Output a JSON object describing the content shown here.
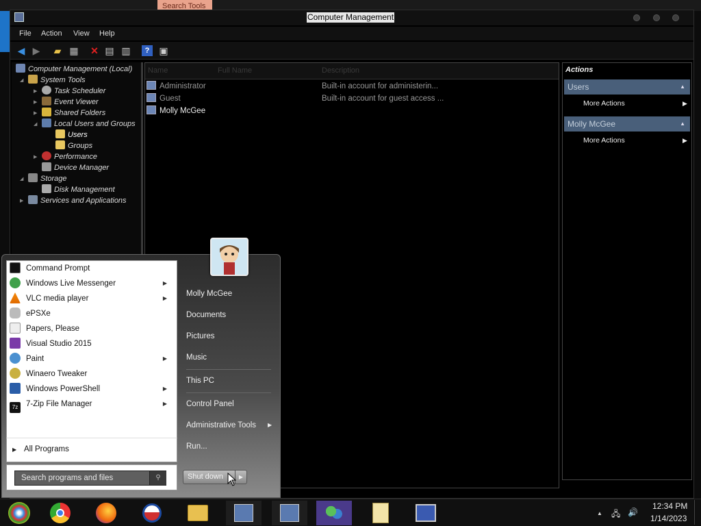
{
  "background": {
    "tab_label": "Search Tools"
  },
  "window": {
    "title": "Computer Management",
    "menu": [
      "File",
      "Action",
      "View",
      "Help"
    ]
  },
  "tree": [
    {
      "label": "Computer Management (Local)"
    },
    {
      "label": "System Tools"
    },
    {
      "label": "Task Scheduler"
    },
    {
      "label": "Event Viewer"
    },
    {
      "label": "Shared Folders"
    },
    {
      "label": "Local Users and Groups"
    },
    {
      "label": "Users"
    },
    {
      "label": "Groups"
    },
    {
      "label": "Performance"
    },
    {
      "label": "Device Manager"
    },
    {
      "label": "Storage"
    },
    {
      "label": "Disk Management"
    },
    {
      "label": "Services and Applications"
    }
  ],
  "list": {
    "columns": [
      "Name",
      "Full Name",
      "Description"
    ],
    "rows": [
      {
        "name": "Administrator",
        "description": "Built-in account for administerin..."
      },
      {
        "name": "Guest",
        "description": "Built-in account for guest access ..."
      },
      {
        "name": "Molly McGee",
        "description": ""
      }
    ]
  },
  "actions": {
    "title": "Actions",
    "sections": [
      {
        "label": "Users",
        "item": "More Actions"
      },
      {
        "label": "Molly McGee",
        "item": "More Actions"
      }
    ]
  },
  "start_menu": {
    "programs": [
      {
        "label": "Command Prompt",
        "icon": "cmd-icon",
        "submenu": false
      },
      {
        "label": "Windows Live Messenger",
        "icon": "messenger-icon",
        "submenu": true
      },
      {
        "label": "VLC media player",
        "icon": "vlc-icon",
        "submenu": true
      },
      {
        "label": "ePSXe",
        "icon": "gamepad-icon",
        "submenu": false
      },
      {
        "label": "Papers, Please",
        "icon": "document-icon",
        "submenu": false
      },
      {
        "label": "Visual Studio 2015",
        "icon": "visual-studio-icon",
        "submenu": false
      },
      {
        "label": "Paint",
        "icon": "paint-icon",
        "submenu": true
      },
      {
        "label": "Winaero Tweaker",
        "icon": "tweaker-icon",
        "submenu": false
      },
      {
        "label": "Windows PowerShell",
        "icon": "powershell-icon",
        "submenu": true
      },
      {
        "label": "7-Zip File Manager",
        "icon": "7zip-icon",
        "submenu": true
      }
    ],
    "all_programs": "All Programs",
    "search_placeholder": "Search programs and files",
    "right_links": {
      "user": "Molly McGee",
      "documents": "Documents",
      "pictures": "Pictures",
      "music": "Music",
      "this_pc": "This PC",
      "control_panel": "Control Panel",
      "admin_tools": "Administrative Tools",
      "run": "Run..."
    },
    "shutdown": "Shut down"
  },
  "taskbar": {
    "time": "12:34 PM",
    "date": "1/14/2023",
    "apps": [
      "start-orb-icon",
      "chrome-icon",
      "firefox-icon",
      "obama-logo-icon",
      "file-explorer-icon",
      "computer-management-icon",
      "computer-management-icon",
      "messenger-icon",
      "notepad-icon",
      "remote-desktop-icon"
    ]
  }
}
